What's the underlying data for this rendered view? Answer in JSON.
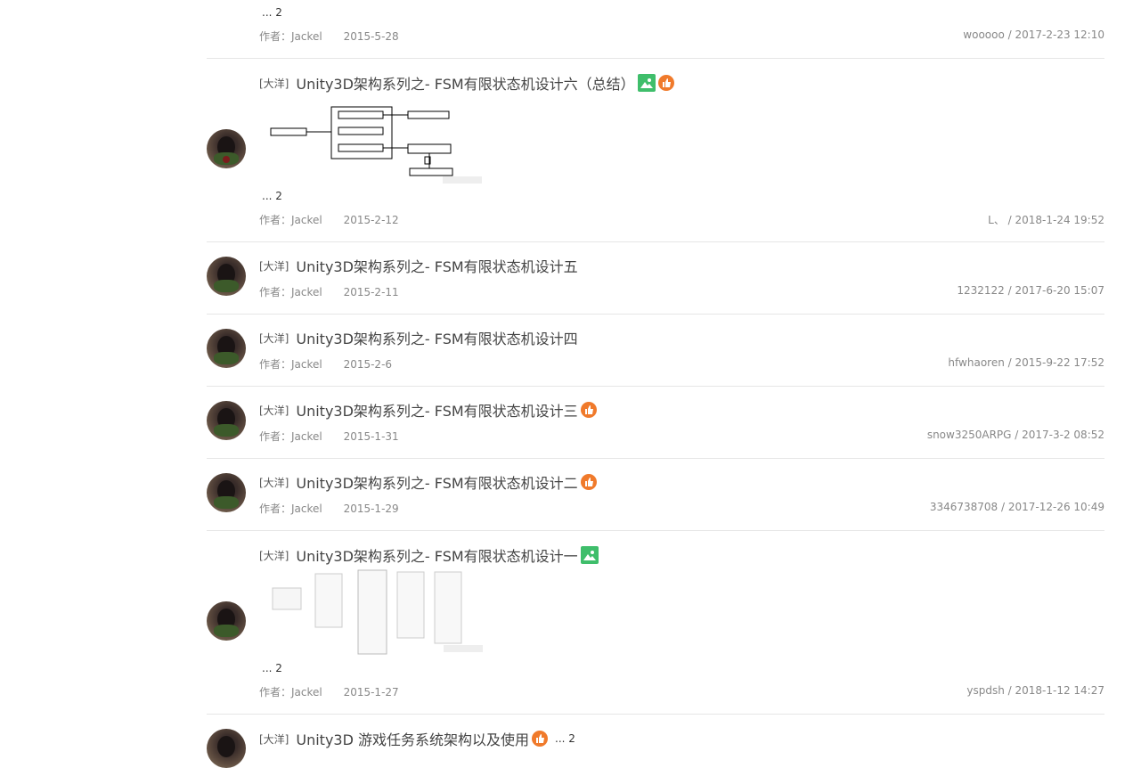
{
  "threads": [
    {
      "author_prefix": "作者：Jackel",
      "date": "2015-5-28",
      "last": "wooooo / 2017-2-23 12:10",
      "pages": "... 2"
    },
    {
      "tag": "[大洋]",
      "title": "Unity3D架构系列之- FSM有限状态机设计六（总结）",
      "author_prefix": "作者：Jackel",
      "date": "2015-2-12",
      "last": "L、 / 2018-1-24 19:52",
      "pages": "... 2"
    },
    {
      "tag": "[大洋]",
      "title": "Unity3D架构系列之- FSM有限状态机设计五",
      "author_prefix": "作者：Jackel",
      "date": "2015-2-11",
      "last": "1232122 / 2017-6-20 15:07"
    },
    {
      "tag": "[大洋]",
      "title": "Unity3D架构系列之- FSM有限状态机设计四",
      "author_prefix": "作者：Jackel",
      "date": "2015-2-6",
      "last": "hfwhaoren / 2015-9-22 17:52"
    },
    {
      "tag": "[大洋]",
      "title": "Unity3D架构系列之- FSM有限状态机设计三",
      "author_prefix": "作者：Jackel",
      "date": "2015-1-31",
      "last": "snow3250ARPG / 2017-3-2 08:52"
    },
    {
      "tag": "[大洋]",
      "title": "Unity3D架构系列之- FSM有限状态机设计二",
      "author_prefix": "作者：Jackel",
      "date": "2015-1-29",
      "last": "3346738708 / 2017-12-26 10:49"
    },
    {
      "tag": "[大洋]",
      "title": "Unity3D架构系列之- FSM有限状态机设计一",
      "author_prefix": "作者：Jackel",
      "date": "2015-1-27",
      "last": "yspdsh / 2018-1-12 14:27",
      "pages": "... 2"
    },
    {
      "tag": "[大洋]",
      "title": "Unity3D 游戏任务系统架构以及使用",
      "pages": "... 2"
    }
  ],
  "icons": {
    "image": "image-icon",
    "hot": "thumbs-up-icon"
  },
  "colors": {
    "image_icon": "#3fbe6b",
    "hot_icon": "#f07a2b",
    "divider": "#e6e6e6"
  }
}
